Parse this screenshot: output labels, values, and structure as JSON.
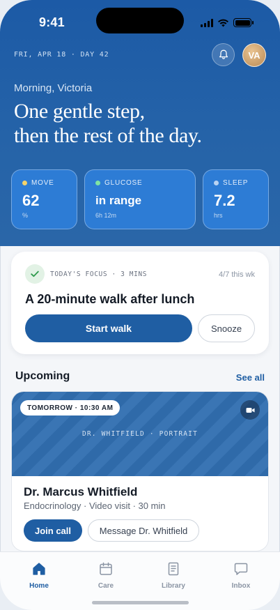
{
  "status_bar": {
    "time": "9:41"
  },
  "header": {
    "dateline": "FRI, APR 18 · DAY 42",
    "avatar_initials": "VA",
    "greeting": "Morning, Victoria",
    "headline_line1": "One gentle step,",
    "headline_line2": "then the rest of the day."
  },
  "stats": [
    {
      "label": "MOVE",
      "value": "62",
      "sub": "%",
      "dot_color": "#f2d36b"
    },
    {
      "label": "GLUCOSE",
      "value": "in range",
      "sub": "6h 12m",
      "dot_color": "#7fe3a3"
    },
    {
      "label": "SLEEP",
      "value": "7.2",
      "sub": "hrs",
      "dot_color": "#b9d3f2"
    }
  ],
  "focus": {
    "label": "TODAY'S FOCUS · 3 MINS",
    "count": "4/7 this wk",
    "title": "A 20-minute walk after lunch",
    "primary_label": "Start walk",
    "secondary_label": "Snooze"
  },
  "upcoming": {
    "title": "Upcoming",
    "see_all": "See all",
    "appointment": {
      "chip": "TOMORROW · 10:30 AM",
      "portrait_caption": "DR. WHITFIELD · PORTRAIT",
      "doctor": "Dr. Marcus Whitfield",
      "meta": "Endocrinology · Video visit · 30 min",
      "join_label": "Join call",
      "message_label": "Message Dr. Whitfield"
    }
  },
  "tabs": [
    {
      "label": "Home",
      "icon": "home-icon",
      "active": true
    },
    {
      "label": "Care",
      "icon": "calendar-icon",
      "active": false
    },
    {
      "label": "Library",
      "icon": "book-icon",
      "active": false
    },
    {
      "label": "Inbox",
      "icon": "chat-bubble-icon",
      "active": false
    }
  ],
  "colors": {
    "brand": "#1f5ea3",
    "hero": "#2563a8",
    "stat_tile": "#2d7cd5"
  }
}
